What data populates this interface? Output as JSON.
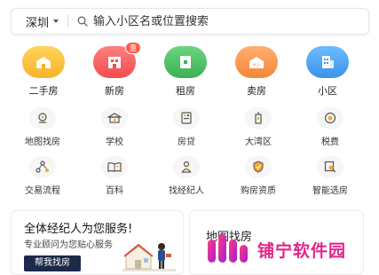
{
  "search": {
    "city": "深圳",
    "placeholder": "输入小区名或位置搜索"
  },
  "primary_nav": [
    {
      "label": "二手房",
      "icon": "second-hand-home-icon",
      "color": "#ffc53d"
    },
    {
      "label": "新房",
      "icon": "new-home-icon",
      "color": "#ff6b6b",
      "badge": "惠"
    },
    {
      "label": "租房",
      "icon": "rent-icon",
      "color": "#52c468"
    },
    {
      "label": "卖房",
      "icon": "sell-home-icon",
      "color": "#ff9a52"
    },
    {
      "label": "小区",
      "icon": "community-icon",
      "color": "#4aa6f5"
    }
  ],
  "secondary_nav": [
    {
      "label": "地图找房",
      "icon": "map-search-icon"
    },
    {
      "label": "学校",
      "icon": "school-icon"
    },
    {
      "label": "房贷",
      "icon": "mortgage-icon"
    },
    {
      "label": "大湾区",
      "icon": "greater-bay-icon"
    },
    {
      "label": "税费",
      "icon": "tax-icon"
    },
    {
      "label": "交易流程",
      "icon": "process-icon"
    },
    {
      "label": "百科",
      "icon": "encyclopedia-icon"
    },
    {
      "label": "找经纪人",
      "icon": "find-agent-icon"
    },
    {
      "label": "购房资质",
      "icon": "qualification-icon"
    },
    {
      "label": "智能选房",
      "icon": "smart-select-icon"
    }
  ],
  "promo_left": {
    "title": "全体经纪人为您服务!",
    "subtitle": "专业顾问为您贴心服务",
    "button": "帮我找房"
  },
  "promo_right": {
    "title": "地图找房"
  },
  "watermark": {
    "text": "铺宁软件园"
  }
}
